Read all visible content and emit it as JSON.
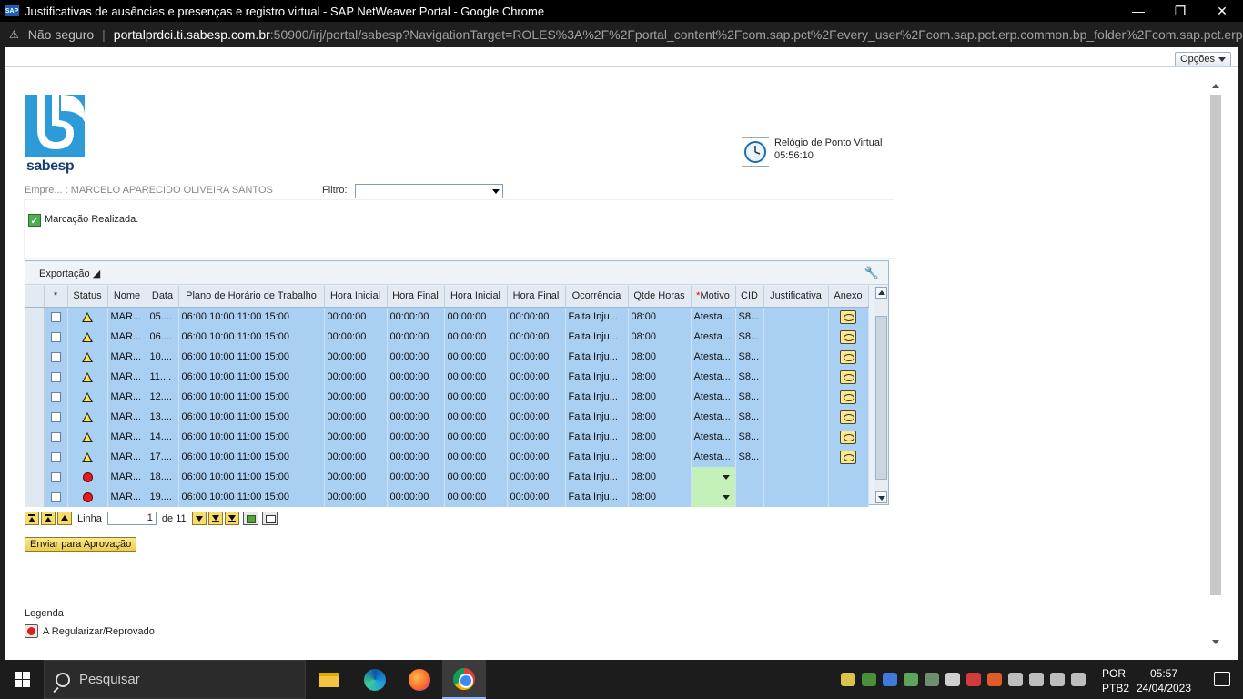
{
  "browser": {
    "window_title": "Justificativas de ausências e presenças e registro virtual - SAP NetWeaver Portal - Google Chrome",
    "app_icon_label": "SAP",
    "insecure_label": "Não seguro",
    "url_host": "portalprdci.ti.sabesp.com.br",
    "url_path": ":50900/irj/portal/sabesp?NavigationTarget=ROLES%3A%2F%2Fportal_content%2Fcom.sap.pct%2Fevery_user%2Fcom.sap.pct.erp.common.bp_folder%2Fcom.sap.pct.erp.c..."
  },
  "portal": {
    "opcoes_label": "Opções",
    "logo_text": "sabesp",
    "clock_title": "Relógio de Ponto Virtual",
    "clock_time": "05:56:10",
    "employee_label": "Empre... : MARCELO APARECIDO OLIVEIRA SANTOS",
    "filter_label": "Filtro:",
    "filter_value": "",
    "message": "Marcação Realizada.",
    "export_label": "Exportação"
  },
  "table": {
    "columns": [
      "*",
      "Status",
      "Nome",
      "Data",
      "Plano de Horário de Trabalho",
      "Hora Inicial",
      "Hora Final",
      "Hora Inicial",
      "Hora Final",
      "Ocorrência",
      "Qtde Horas",
      "Motivo",
      "CID",
      "Justificativa",
      "Anexo"
    ],
    "rows": [
      {
        "status": "warning",
        "nome": "MAR...",
        "data": "05....",
        "plano": "06:00 10:00 11:00 15:00",
        "hi1": "00:00:00",
        "hf1": "00:00:00",
        "hi2": "00:00:00",
        "hf2": "00:00:00",
        "ocorrencia": "Falta Inju...",
        "qtde": "08:00",
        "motivo": "Atesta...",
        "cid": "S8...",
        "justificativa": "",
        "anexo": true
      },
      {
        "status": "warning",
        "nome": "MAR...",
        "data": "06....",
        "plano": "06:00 10:00 11:00 15:00",
        "hi1": "00:00:00",
        "hf1": "00:00:00",
        "hi2": "00:00:00",
        "hf2": "00:00:00",
        "ocorrencia": "Falta Inju...",
        "qtde": "08:00",
        "motivo": "Atesta...",
        "cid": "S8...",
        "justificativa": "",
        "anexo": true
      },
      {
        "status": "warning",
        "nome": "MAR...",
        "data": "10....",
        "plano": "06:00 10:00 11:00 15:00",
        "hi1": "00:00:00",
        "hf1": "00:00:00",
        "hi2": "00:00:00",
        "hf2": "00:00:00",
        "ocorrencia": "Falta Inju...",
        "qtde": "08:00",
        "motivo": "Atesta...",
        "cid": "S8...",
        "justificativa": "",
        "anexo": true
      },
      {
        "status": "warning",
        "nome": "MAR...",
        "data": "11....",
        "plano": "06:00 10:00 11:00 15:00",
        "hi1": "00:00:00",
        "hf1": "00:00:00",
        "hi2": "00:00:00",
        "hf2": "00:00:00",
        "ocorrencia": "Falta Inju...",
        "qtde": "08:00",
        "motivo": "Atesta...",
        "cid": "S8...",
        "justificativa": "",
        "anexo": true
      },
      {
        "status": "warning",
        "nome": "MAR...",
        "data": "12....",
        "plano": "06:00 10:00 11:00 15:00",
        "hi1": "00:00:00",
        "hf1": "00:00:00",
        "hi2": "00:00:00",
        "hf2": "00:00:00",
        "ocorrencia": "Falta Inju...",
        "qtde": "08:00",
        "motivo": "Atesta...",
        "cid": "S8...",
        "justificativa": "",
        "anexo": true
      },
      {
        "status": "warning",
        "nome": "MAR...",
        "data": "13....",
        "plano": "06:00 10:00 11:00 15:00",
        "hi1": "00:00:00",
        "hf1": "00:00:00",
        "hi2": "00:00:00",
        "hf2": "00:00:00",
        "ocorrencia": "Falta Inju...",
        "qtde": "08:00",
        "motivo": "Atesta...",
        "cid": "S8...",
        "justificativa": "",
        "anexo": true
      },
      {
        "status": "warning",
        "nome": "MAR...",
        "data": "14....",
        "plano": "06:00 10:00 11:00 15:00",
        "hi1": "00:00:00",
        "hf1": "00:00:00",
        "hi2": "00:00:00",
        "hf2": "00:00:00",
        "ocorrencia": "Falta Inju...",
        "qtde": "08:00",
        "motivo": "Atesta...",
        "cid": "S8...",
        "justificativa": "",
        "anexo": true
      },
      {
        "status": "warning",
        "nome": "MAR...",
        "data": "17....",
        "plano": "06:00 10:00 11:00 15:00",
        "hi1": "00:00:00",
        "hf1": "00:00:00",
        "hi2": "00:00:00",
        "hf2": "00:00:00",
        "ocorrencia": "Falta Inju...",
        "qtde": "08:00",
        "motivo": "Atesta...",
        "cid": "S8...",
        "justificativa": "",
        "anexo": true
      },
      {
        "status": "error",
        "nome": "MAR...",
        "data": "18....",
        "plano": "06:00 10:00 11:00 15:00",
        "hi1": "00:00:00",
        "hf1": "00:00:00",
        "hi2": "00:00:00",
        "hf2": "00:00:00",
        "ocorrencia": "Falta Inju...",
        "qtde": "08:00",
        "motivo": "",
        "cid": "",
        "justificativa": "",
        "anexo": false
      },
      {
        "status": "error",
        "nome": "MAR...",
        "data": "19....",
        "plano": "06:00 10:00 11:00 15:00",
        "hi1": "00:00:00",
        "hf1": "00:00:00",
        "hi2": "00:00:00",
        "hf2": "00:00:00",
        "ocorrencia": "Falta Inju...",
        "qtde": "08:00",
        "motivo": "",
        "cid": "",
        "justificativa": "",
        "anexo": false
      }
    ]
  },
  "paging": {
    "linha_label": "Linha",
    "linha_value": "1",
    "de_label": "de 11"
  },
  "actions": {
    "approve_label": "Enviar para Aprovação"
  },
  "legend": {
    "title": "Legenda",
    "item_label": "A Regularizar/Reprovado"
  },
  "taskbar": {
    "search_placeholder": "Pesquisar",
    "lang_line1": "POR",
    "lang_line2": "PTB2",
    "time": "05:57",
    "date": "24/04/2023"
  },
  "colors": {
    "row_bg": "#a9cff2",
    "motivo_dropdown_bg": "#c4f0b9",
    "approve_button_bg": "#efcc4b",
    "error_red": "#e21b1b",
    "warning_yellow": "#ffe640"
  }
}
